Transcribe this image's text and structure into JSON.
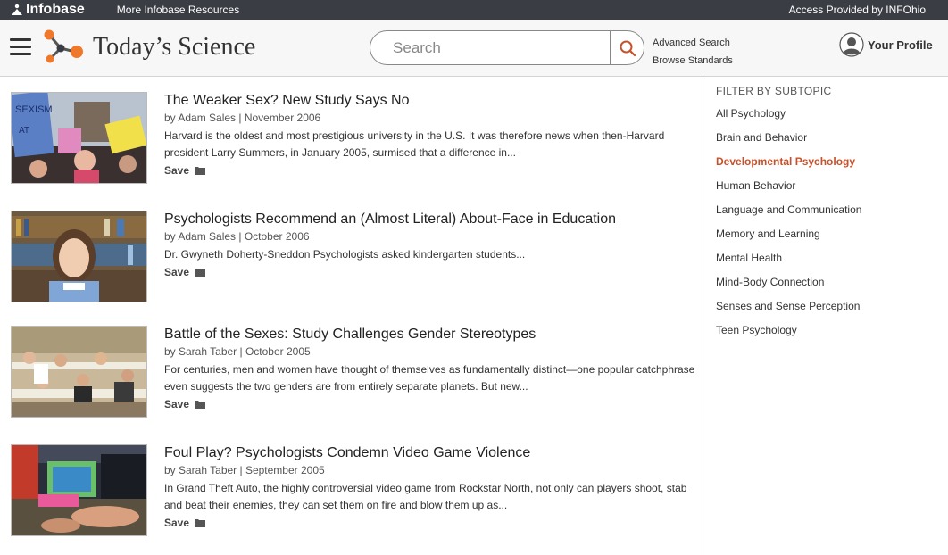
{
  "topbar": {
    "logo_text": "Infobase",
    "more_resources": "More Infobase Resources",
    "access": "Access Provided by INFOhio"
  },
  "header": {
    "title": "Today’s Science",
    "search": {
      "placeholder": "Search"
    },
    "advanced_search": "Advanced Search",
    "browse_standards": "Browse Standards",
    "profile_label": "Your Profile"
  },
  "articles": [
    {
      "title": "The Weaker Sex? New Study Says No",
      "meta": "by Adam Sales | November 2006",
      "snippet": "Harvard is the oldest and most prestigious university in the U.S. It was therefore news when then-Harvard president Larry Summers, in January 2005, surmised that a difference in...",
      "save": "Save"
    },
    {
      "title": "Psychologists Recommend an (Almost Literal) About-Face in Education",
      "meta": "by Adam Sales | October 2006",
      "snippet": "Dr. Gwyneth Doherty-Sneddon Psychologists asked kindergarten students...",
      "save": "Save"
    },
    {
      "title": "Battle of the Sexes: Study Challenges Gender Stereotypes",
      "meta": "by Sarah Taber | October 2005",
      "snippet": "For centuries, men and women have thought of themselves as fundamentally distinct—one popular catchphrase even suggests the two genders are from entirely separate planets. But new...",
      "save": "Save"
    },
    {
      "title": "Foul Play? Psychologists Condemn Video Game Violence",
      "meta": "by Sarah Taber | September 2005",
      "snippet": "In Grand Theft Auto, the highly controversial video game from Rockstar North, not only can players shoot, stab and beat their enemies, they can set them on fire and blow them up as...",
      "save": "Save"
    }
  ],
  "sidebar": {
    "heading": "FILTER BY SUBTOPIC",
    "items": [
      "All Psychology",
      "Brain and Behavior",
      "Developmental Psychology",
      "Human Behavior",
      "Language and Communication",
      "Memory and Learning",
      "Mental Health",
      "Mind-Body Connection",
      "Senses and Sense Perception",
      "Teen Psychology"
    ],
    "active_item": "Developmental Psychology"
  },
  "colors": {
    "accent": "#c8502a",
    "topbar": "#3b3d45",
    "header_bg": "#f7f7f7",
    "logo_orange": "#f0782a"
  }
}
